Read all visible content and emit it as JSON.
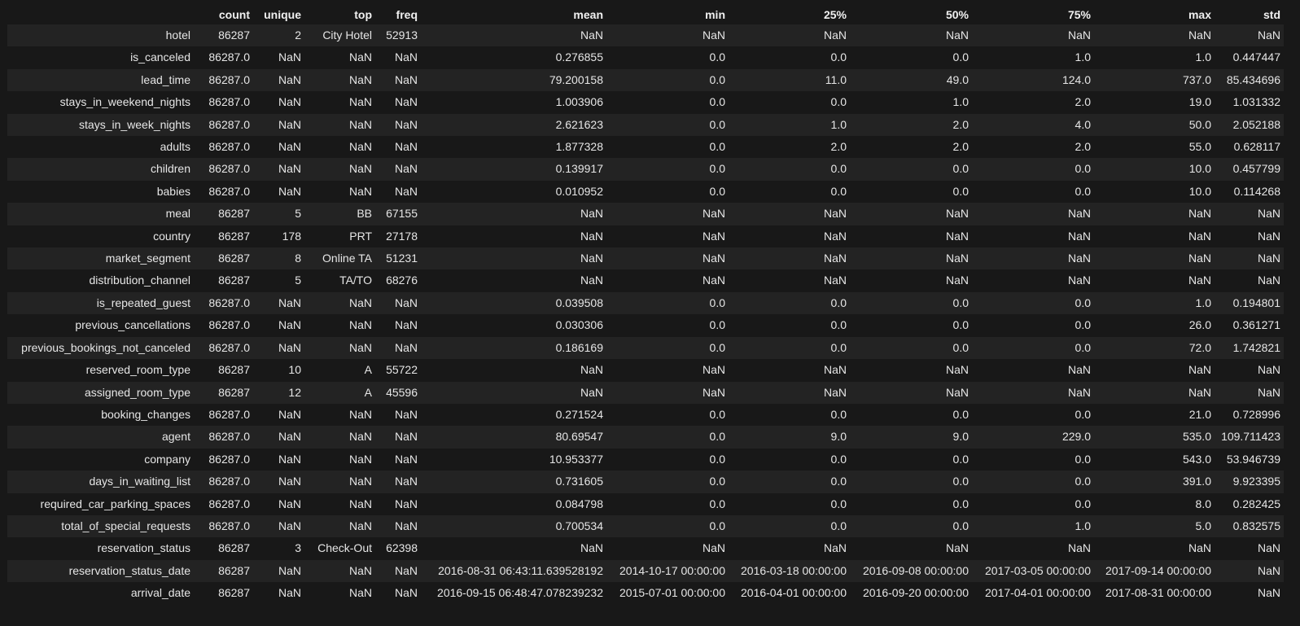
{
  "table": {
    "columns": [
      "",
      "count",
      "unique",
      "top",
      "freq",
      "mean",
      "min",
      "25%",
      "50%",
      "75%",
      "max",
      "std"
    ],
    "rows": [
      [
        "hotel",
        "86287",
        "2",
        "City Hotel",
        "52913",
        "NaN",
        "NaN",
        "NaN",
        "NaN",
        "NaN",
        "NaN",
        "NaN"
      ],
      [
        "is_canceled",
        "86287.0",
        "NaN",
        "NaN",
        "NaN",
        "0.276855",
        "0.0",
        "0.0",
        "0.0",
        "1.0",
        "1.0",
        "0.447447"
      ],
      [
        "lead_time",
        "86287.0",
        "NaN",
        "NaN",
        "NaN",
        "79.200158",
        "0.0",
        "11.0",
        "49.0",
        "124.0",
        "737.0",
        "85.434696"
      ],
      [
        "stays_in_weekend_nights",
        "86287.0",
        "NaN",
        "NaN",
        "NaN",
        "1.003906",
        "0.0",
        "0.0",
        "1.0",
        "2.0",
        "19.0",
        "1.031332"
      ],
      [
        "stays_in_week_nights",
        "86287.0",
        "NaN",
        "NaN",
        "NaN",
        "2.621623",
        "0.0",
        "1.0",
        "2.0",
        "4.0",
        "50.0",
        "2.052188"
      ],
      [
        "adults",
        "86287.0",
        "NaN",
        "NaN",
        "NaN",
        "1.877328",
        "0.0",
        "2.0",
        "2.0",
        "2.0",
        "55.0",
        "0.628117"
      ],
      [
        "children",
        "86287.0",
        "NaN",
        "NaN",
        "NaN",
        "0.139917",
        "0.0",
        "0.0",
        "0.0",
        "0.0",
        "10.0",
        "0.457799"
      ],
      [
        "babies",
        "86287.0",
        "NaN",
        "NaN",
        "NaN",
        "0.010952",
        "0.0",
        "0.0",
        "0.0",
        "0.0",
        "10.0",
        "0.114268"
      ],
      [
        "meal",
        "86287",
        "5",
        "BB",
        "67155",
        "NaN",
        "NaN",
        "NaN",
        "NaN",
        "NaN",
        "NaN",
        "NaN"
      ],
      [
        "country",
        "86287",
        "178",
        "PRT",
        "27178",
        "NaN",
        "NaN",
        "NaN",
        "NaN",
        "NaN",
        "NaN",
        "NaN"
      ],
      [
        "market_segment",
        "86287",
        "8",
        "Online TA",
        "51231",
        "NaN",
        "NaN",
        "NaN",
        "NaN",
        "NaN",
        "NaN",
        "NaN"
      ],
      [
        "distribution_channel",
        "86287",
        "5",
        "TA/TO",
        "68276",
        "NaN",
        "NaN",
        "NaN",
        "NaN",
        "NaN",
        "NaN",
        "NaN"
      ],
      [
        "is_repeated_guest",
        "86287.0",
        "NaN",
        "NaN",
        "NaN",
        "0.039508",
        "0.0",
        "0.0",
        "0.0",
        "0.0",
        "1.0",
        "0.194801"
      ],
      [
        "previous_cancellations",
        "86287.0",
        "NaN",
        "NaN",
        "NaN",
        "0.030306",
        "0.0",
        "0.0",
        "0.0",
        "0.0",
        "26.0",
        "0.361271"
      ],
      [
        "previous_bookings_not_canceled",
        "86287.0",
        "NaN",
        "NaN",
        "NaN",
        "0.186169",
        "0.0",
        "0.0",
        "0.0",
        "0.0",
        "72.0",
        "1.742821"
      ],
      [
        "reserved_room_type",
        "86287",
        "10",
        "A",
        "55722",
        "NaN",
        "NaN",
        "NaN",
        "NaN",
        "NaN",
        "NaN",
        "NaN"
      ],
      [
        "assigned_room_type",
        "86287",
        "12",
        "A",
        "45596",
        "NaN",
        "NaN",
        "NaN",
        "NaN",
        "NaN",
        "NaN",
        "NaN"
      ],
      [
        "booking_changes",
        "86287.0",
        "NaN",
        "NaN",
        "NaN",
        "0.271524",
        "0.0",
        "0.0",
        "0.0",
        "0.0",
        "21.0",
        "0.728996"
      ],
      [
        "agent",
        "86287.0",
        "NaN",
        "NaN",
        "NaN",
        "80.69547",
        "0.0",
        "9.0",
        "9.0",
        "229.0",
        "535.0",
        "109.711423"
      ],
      [
        "company",
        "86287.0",
        "NaN",
        "NaN",
        "NaN",
        "10.953377",
        "0.0",
        "0.0",
        "0.0",
        "0.0",
        "543.0",
        "53.946739"
      ],
      [
        "days_in_waiting_list",
        "86287.0",
        "NaN",
        "NaN",
        "NaN",
        "0.731605",
        "0.0",
        "0.0",
        "0.0",
        "0.0",
        "391.0",
        "9.923395"
      ],
      [
        "required_car_parking_spaces",
        "86287.0",
        "NaN",
        "NaN",
        "NaN",
        "0.084798",
        "0.0",
        "0.0",
        "0.0",
        "0.0",
        "8.0",
        "0.282425"
      ],
      [
        "total_of_special_requests",
        "86287.0",
        "NaN",
        "NaN",
        "NaN",
        "0.700534",
        "0.0",
        "0.0",
        "0.0",
        "1.0",
        "5.0",
        "0.832575"
      ],
      [
        "reservation_status",
        "86287",
        "3",
        "Check-Out",
        "62398",
        "NaN",
        "NaN",
        "NaN",
        "NaN",
        "NaN",
        "NaN",
        "NaN"
      ],
      [
        "reservation_status_date",
        "86287",
        "NaN",
        "NaN",
        "NaN",
        "2016-08-31 06:43:11.639528192",
        "2014-10-17 00:00:00",
        "2016-03-18 00:00:00",
        "2016-09-08 00:00:00",
        "2017-03-05 00:00:00",
        "2017-09-14 00:00:00",
        "NaN"
      ],
      [
        "arrival_date",
        "86287",
        "NaN",
        "NaN",
        "NaN",
        "2016-09-15 06:48:47.078239232",
        "2015-07-01 00:00:00",
        "2016-04-01 00:00:00",
        "2016-09-20 00:00:00",
        "2017-04-01 00:00:00",
        "2017-08-31 00:00:00",
        "NaN"
      ]
    ]
  }
}
